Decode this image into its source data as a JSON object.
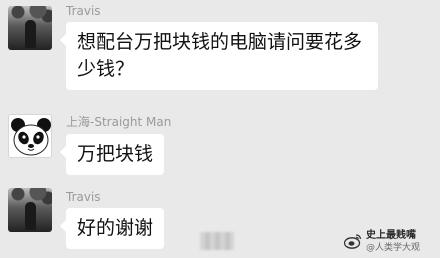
{
  "messages": [
    {
      "sender": "Travis",
      "text_line1": "想配台万把块钱的电脑请问要花多",
      "text_line2": "少钱？",
      "avatar": "travis-photo-avatar"
    },
    {
      "sender": "上海-Straight Man",
      "text": "万把块钱",
      "avatar": "panda-avatar"
    },
    {
      "sender": "Travis",
      "text": "好的谢谢",
      "avatar": "travis-photo-avatar"
    }
  ],
  "watermark": {
    "title": "史上最贱嘴",
    "subtitle": "@人类学大观"
  },
  "colors": {
    "background": "#e9e9e9",
    "bubble": "#ffffff",
    "name_text": "#9a9a9a"
  }
}
